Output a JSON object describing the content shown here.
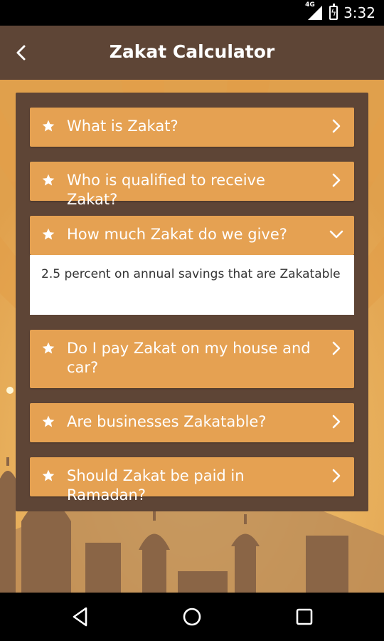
{
  "status_bar": {
    "network": "4G",
    "time": "3:32"
  },
  "header": {
    "title": "Zakat Calculator",
    "back_icon": "chevron-left-icon"
  },
  "faq_items": [
    {
      "question": "What is Zakat?",
      "expanded": false
    },
    {
      "question": "Who is qualified to receive Zakat?",
      "expanded": false
    },
    {
      "question": "How much Zakat do we give?",
      "expanded": true,
      "answer": "2.5 percent on annual savings that are Zakatable"
    },
    {
      "question": "Do I pay Zakat on my house and car?",
      "expanded": false
    },
    {
      "question": "Are businesses Zakatable?",
      "expanded": false
    },
    {
      "question": "Should Zakat be paid in Ramadan?",
      "expanded": false
    }
  ],
  "colors": {
    "header_bg": "#5e4536",
    "panel_bg": "#5e4536",
    "item_bg": "#e5a152",
    "background_orange": "#e8ad56",
    "silhouette": "#8a6546"
  },
  "navigation": {
    "back_icon": "triangle-back-icon",
    "home_icon": "circle-home-icon",
    "recents_icon": "square-recents-icon"
  }
}
